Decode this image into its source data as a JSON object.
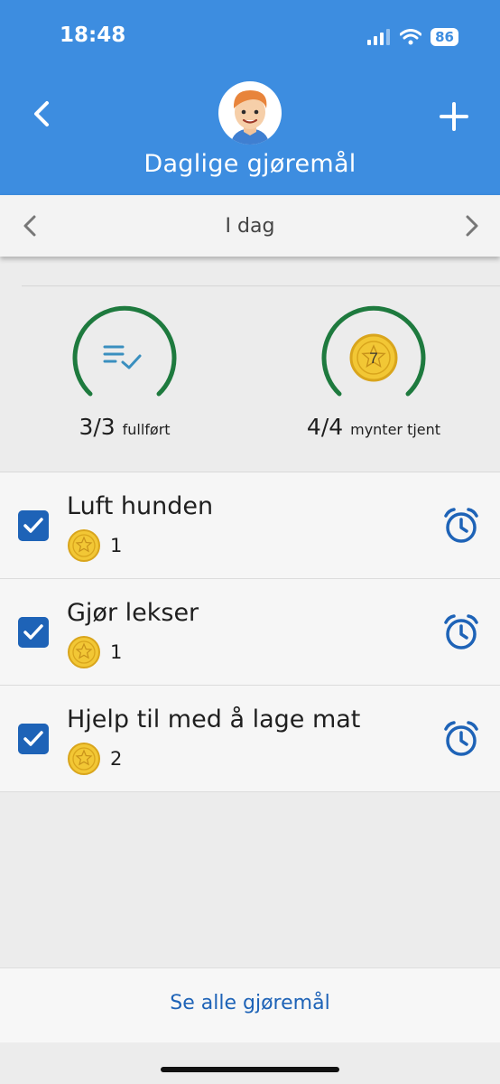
{
  "status_bar": {
    "time": "18:48",
    "battery": "86"
  },
  "header": {
    "title": "Daglige gjøremål"
  },
  "date_nav": {
    "label": "I dag"
  },
  "stats": {
    "completed": {
      "value": "3/3",
      "label": "fullført"
    },
    "coins": {
      "value": "4/4",
      "label": "mynter tjent",
      "badge": "7"
    }
  },
  "chores": [
    {
      "title": "Luft hunden",
      "coins": "1",
      "checked": true
    },
    {
      "title": "Gjør lekser",
      "coins": "1",
      "checked": true
    },
    {
      "title": "Hjelp til med å lage mat",
      "coins": "2",
      "checked": true
    }
  ],
  "footer": {
    "see_all": "Se alle gjøremål"
  },
  "colors": {
    "header": "#3d8de0",
    "accent": "#1e63b7",
    "progress": "#1e7a3e",
    "coin": "#e6b521"
  },
  "icons": [
    "back-icon",
    "add-icon",
    "chevron-left-icon",
    "chevron-right-icon",
    "checklist-icon",
    "coin-icon",
    "checkbox-icon",
    "alarm-clock-icon"
  ]
}
